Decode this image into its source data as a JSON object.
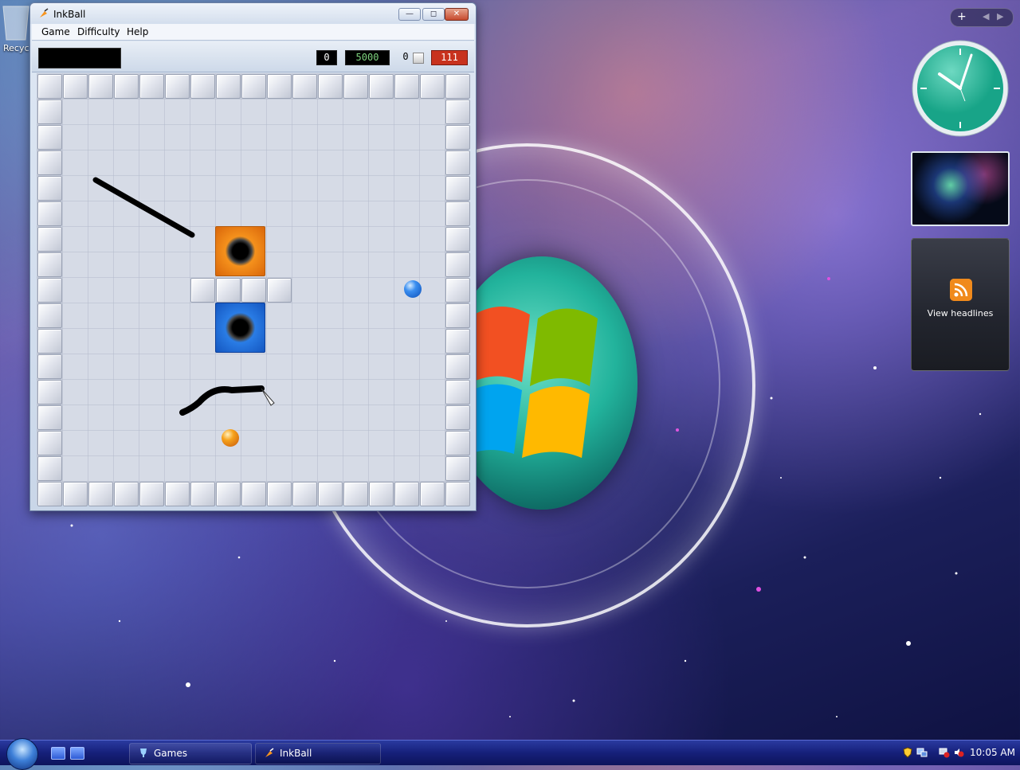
{
  "desktop": {
    "recycle_bin_label": "Recyc"
  },
  "window": {
    "title": "InkBall",
    "controls": {
      "minimize": "—",
      "restore": "◻",
      "close": "✕"
    }
  },
  "menu": {
    "items": [
      "Game",
      "Difficulty",
      "Help"
    ]
  },
  "status": {
    "score_left": "0",
    "time": "5000",
    "small_count": "0",
    "score_right": "111"
  },
  "colors": {
    "score_red": "#c8321e",
    "time_green": "#7fd47f",
    "hole_orange": "#f7941d",
    "hole_blue": "#2b7fe8",
    "taskbar": "#16207a"
  },
  "gadgets": {
    "feeds_label": "View headlines",
    "clock_icon": "analog-clock-icon",
    "feeds_icon": "rss-icon"
  },
  "taskbar": {
    "tasks": [
      "Games",
      "InkBall"
    ],
    "time": "10:05 AM"
  }
}
